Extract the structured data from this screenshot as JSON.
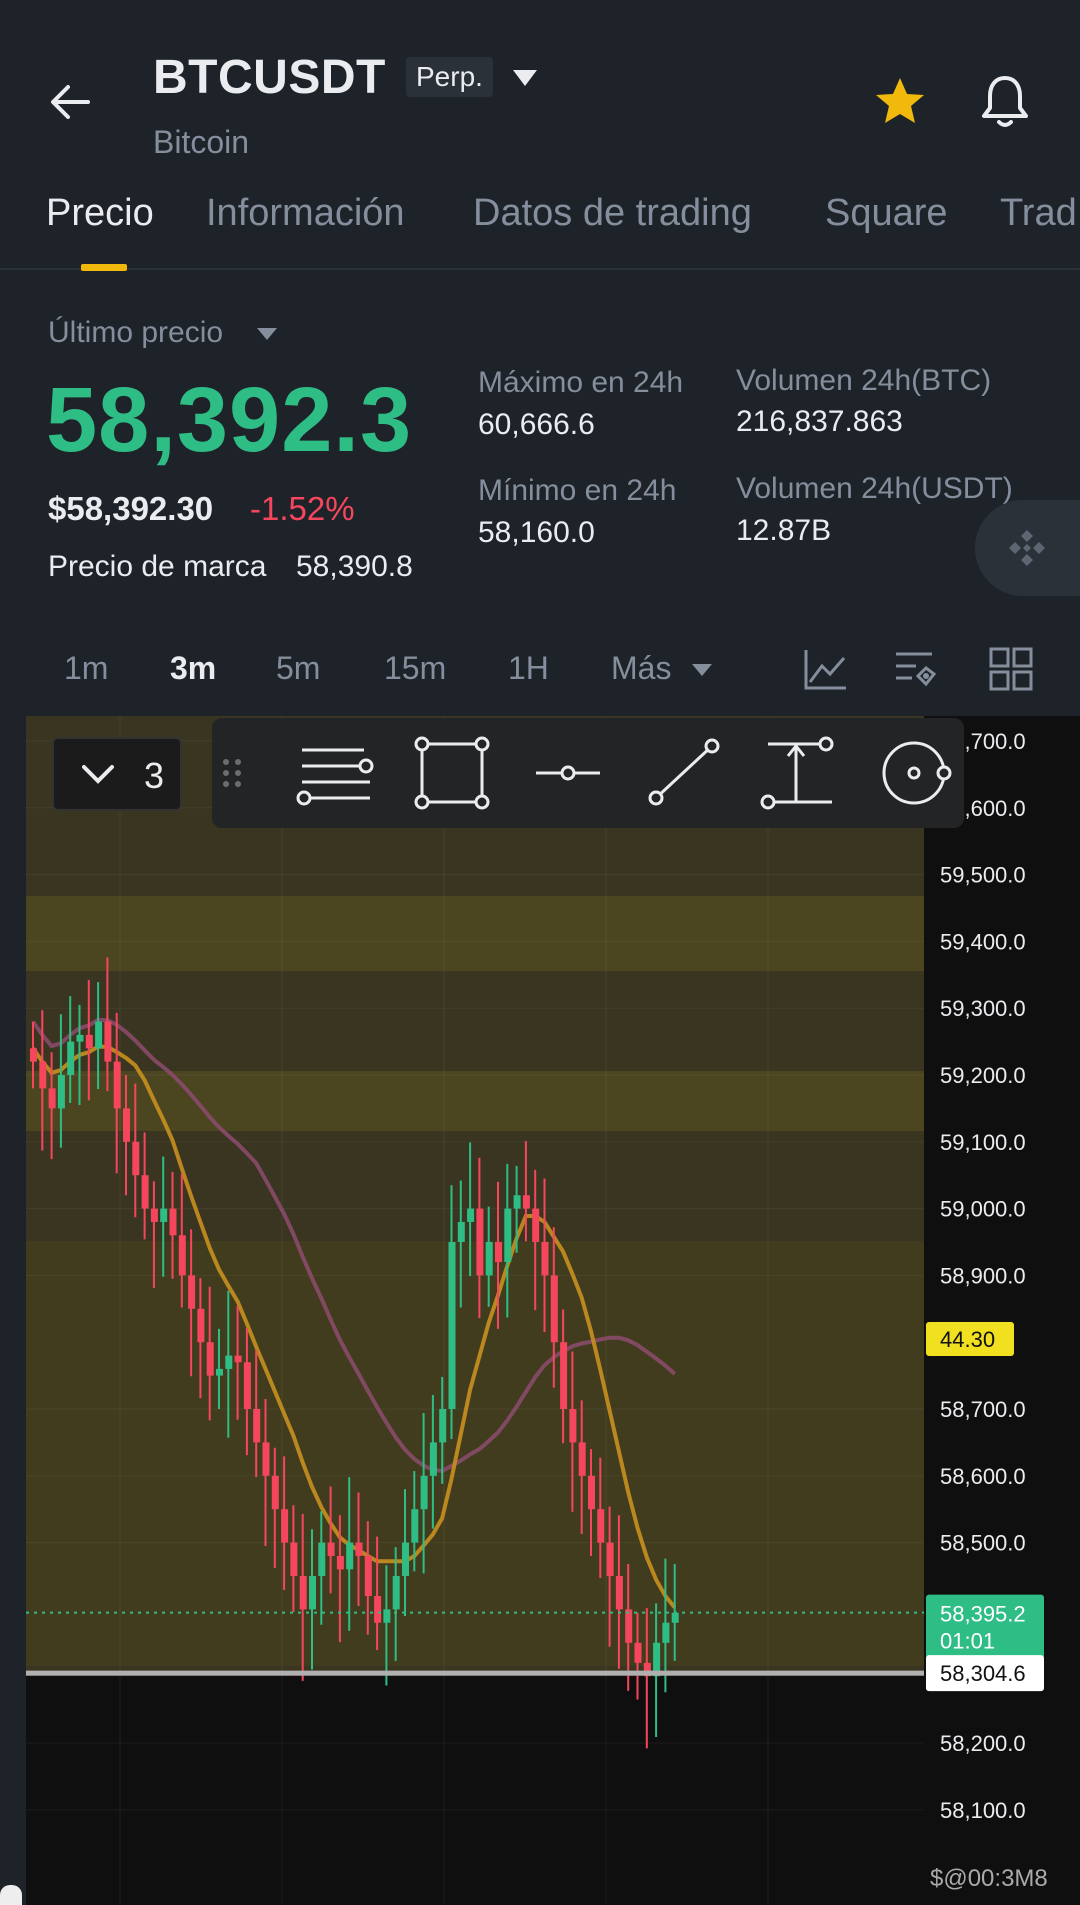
{
  "header": {
    "symbol": "BTCUSDT",
    "contract_badge": "Perp.",
    "name": "Bitcoin",
    "icons": [
      "back-arrow-icon",
      "caret-down-icon",
      "star-icon",
      "bell-icon"
    ],
    "star_color": "#f0b90b"
  },
  "tabs": [
    "Precio",
    "Información",
    "Datos de trading",
    "Square",
    "Trad"
  ],
  "active_tab": "Precio",
  "stats": {
    "last_price_label": "Último precio",
    "last_price": "58,392.3",
    "usd_price": "$58,392.30",
    "change_pct": "-1.52%",
    "mark_label": "Precio de marca",
    "mark_value": "58,390.8",
    "high_label": "Máximo en 24h",
    "high_value": "60,666.6",
    "low_label": "Mínimo en 24h",
    "low_value": "58,160.0",
    "vol_btc_label": "Volumen 24h(BTC)",
    "vol_btc_value": "216,837.863",
    "vol_usdt_label": "Volumen 24h(USDT)",
    "vol_usdt_value": "12.87B"
  },
  "intervals": [
    "1m",
    "3m",
    "5m",
    "15m",
    "1H",
    "Más"
  ],
  "active_interval": "3m",
  "chart_tools": [
    "indicator-icon",
    "chart-settings-icon",
    "layout-grid-icon"
  ],
  "drawing_toolbar": {
    "collapse_count": "3",
    "tools": [
      "drag-handle-icon",
      "fib-retracement-icon",
      "rectangle-icon",
      "horizontal-ray-icon",
      "trend-line-icon",
      "price-range-icon",
      "circle-icon"
    ]
  },
  "colors": {
    "up": "#2ebd85",
    "down": "#f6465d",
    "accent": "#f0b90b",
    "ma_fast": "#c8901e",
    "ma_slow": "#8a4a6a"
  },
  "chart_data": {
    "type": "candlestick",
    "interval": "3m",
    "y_ticks": [
      "59,700.0",
      "59,600.0",
      "59,500.0",
      "59,400.0",
      "59,300.0",
      "59,200.0",
      "59,100.0",
      "59,000.0",
      "58,900.0",
      "58,700.0",
      "58,600.0",
      "58,500.0",
      "58,200.0",
      "58,100.0"
    ],
    "ylim": [
      58050,
      59750
    ],
    "current_price": "58,395.2",
    "countdown": "01:01",
    "line_price": "58,304.6",
    "indicator_value": "44.30",
    "close_series": [
      59220,
      59180,
      59150,
      59200,
      59250,
      59260,
      59240,
      59280,
      59220,
      59150,
      59100,
      59050,
      59000,
      58980,
      59000,
      58960,
      58900,
      58850,
      58800,
      58750,
      58760,
      58780,
      58770,
      58700,
      58650,
      58600,
      58550,
      58500,
      58450,
      58400,
      58450,
      58500,
      58480,
      58460,
      58500,
      58480,
      58420,
      58380,
      58400,
      58450,
      58500,
      58550,
      58600,
      58650,
      58700,
      58950,
      58980,
      59000,
      58900,
      58950,
      58920,
      59000,
      59020,
      59000,
      58950,
      58900,
      58800,
      58700,
      58650,
      58600,
      58550,
      58500,
      58450,
      58400,
      58350,
      58320,
      58300,
      58350,
      58380,
      58395
    ]
  },
  "watermark": "$@00:3M8"
}
